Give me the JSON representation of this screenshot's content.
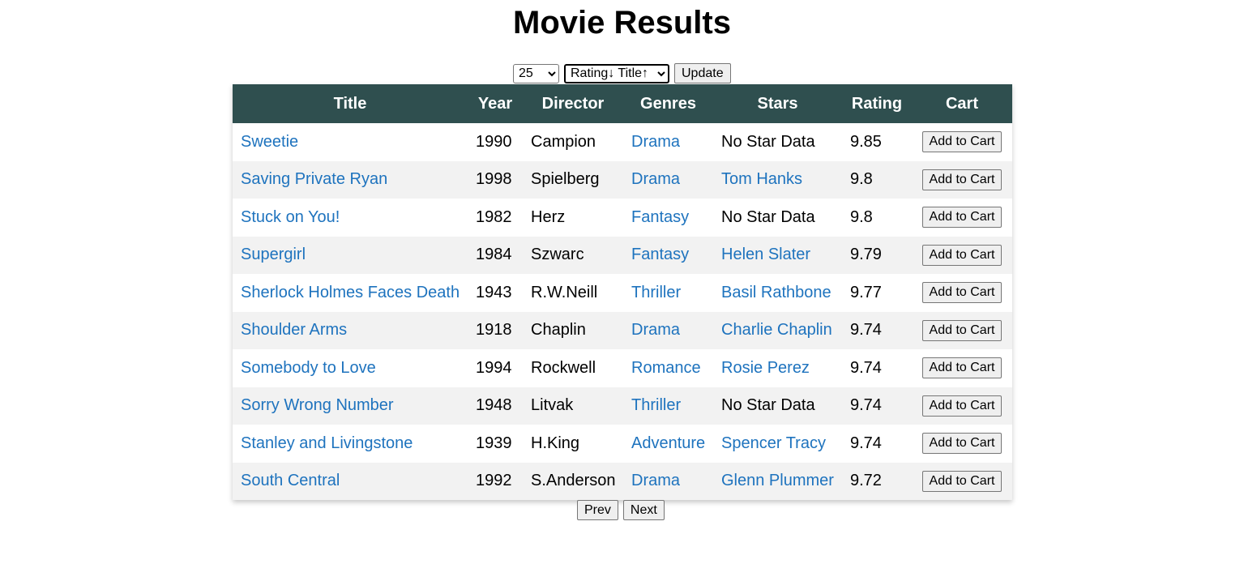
{
  "page": {
    "title": "Movie Results"
  },
  "controls": {
    "per_page": "25",
    "sort": "Rating↓ Title↑",
    "update_label": "Update"
  },
  "table": {
    "headers": [
      "Title",
      "Year",
      "Director",
      "Genres",
      "Stars",
      "Rating",
      "Cart"
    ],
    "rows": [
      {
        "title": "Sweetie",
        "year": "1990",
        "director": "Campion",
        "genre": "Drama",
        "star": "No Star Data",
        "rating": "9.85"
      },
      {
        "title": "Saving Private Ryan",
        "year": "1998",
        "director": "Spielberg",
        "genre": "Drama",
        "star": "Tom Hanks",
        "rating": "9.8"
      },
      {
        "title": "Stuck on You!",
        "year": "1982",
        "director": "Herz",
        "genre": "Fantasy",
        "star": "No Star Data",
        "rating": "9.8"
      },
      {
        "title": "Supergirl",
        "year": "1984",
        "director": "Szwarc",
        "genre": "Fantasy",
        "star": "Helen Slater",
        "rating": "9.79"
      },
      {
        "title": "Sherlock Holmes Faces Death",
        "year": "1943",
        "director": "R.W.Neill",
        "genre": "Thriller",
        "star": "Basil Rathbone",
        "rating": "9.77"
      },
      {
        "title": "Shoulder Arms",
        "year": "1918",
        "director": "Chaplin",
        "genre": "Drama",
        "star": "Charlie Chaplin",
        "rating": "9.74"
      },
      {
        "title": "Somebody to Love",
        "year": "1994",
        "director": "Rockwell",
        "genre": "Romance",
        "star": "Rosie Perez",
        "rating": "9.74"
      },
      {
        "title": "Sorry Wrong Number",
        "year": "1948",
        "director": "Litvak",
        "genre": "Thriller",
        "star": "No Star Data",
        "rating": "9.74"
      },
      {
        "title": "Stanley and Livingstone",
        "year": "1939",
        "director": "H.King",
        "genre": "Adventure",
        "star": "Spencer Tracy",
        "rating": "9.74"
      },
      {
        "title": "South Central",
        "year": "1992",
        "director": "S.Anderson",
        "genre": "Drama",
        "star": "Glenn Plummer",
        "rating": "9.72"
      }
    ],
    "add_to_cart_label": "Add to Cart",
    "no_star_text": "No Star Data"
  },
  "pager": {
    "prev_label": "Prev",
    "next_label": "Next"
  },
  "colors": {
    "header_bg": "#2f4f4f",
    "link": "#1e73be",
    "row_alt": "#f2f2f2"
  }
}
